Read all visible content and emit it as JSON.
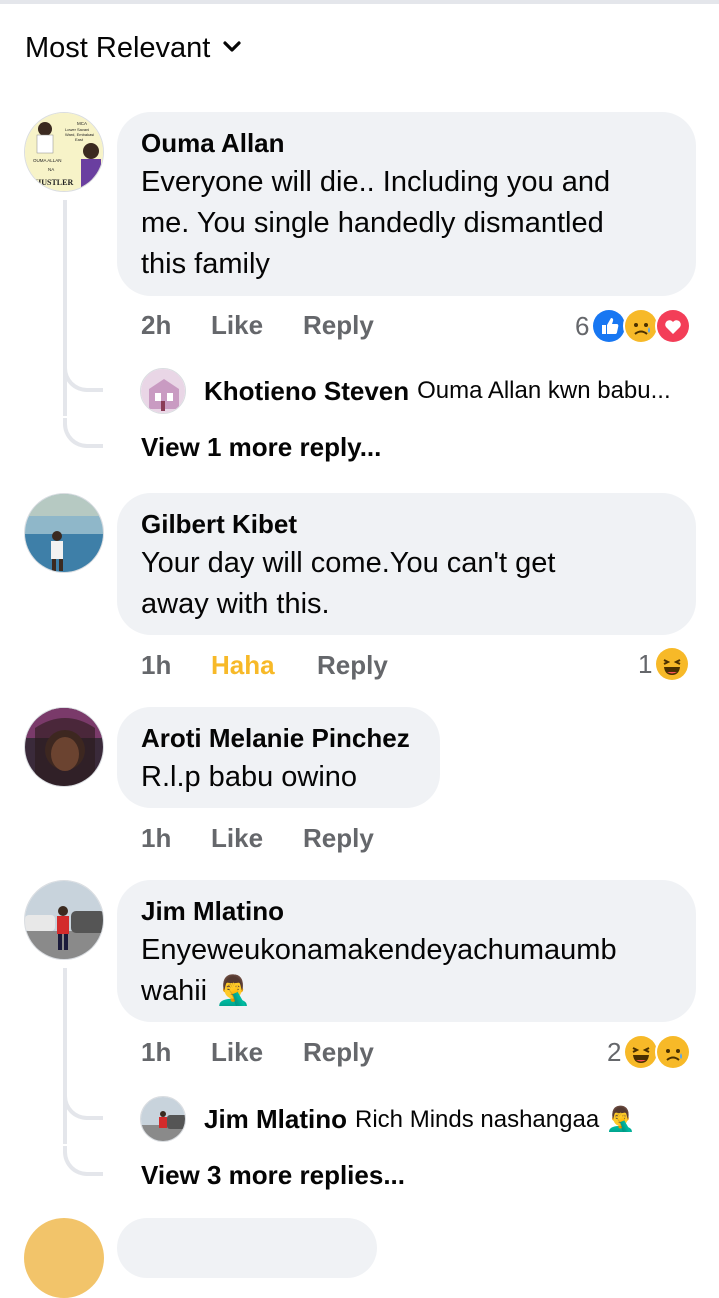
{
  "sort": {
    "label": "Most Relevant",
    "icon": "chevron-down-icon"
  },
  "comments": [
    {
      "name": "Ouma Allan",
      "lines": [
        "Everyone will die.. Including you and",
        "me. You single handedly dismantled",
        "this family"
      ],
      "time": "2h",
      "like_label": "Like",
      "reply_label": "Reply",
      "reaction_count": "6",
      "reactions": [
        "like-reaction-icon",
        "sad-reaction-icon",
        "love-reaction-icon"
      ],
      "avatar_caption": {
        "top": "MCA",
        "mid1": "Lower Savani",
        "mid2": "Ward, Embakasi",
        "mid3": "East",
        "name": "OUMA ALLAN",
        "na": "NA",
        "hustler": "HUSTLER"
      },
      "reply": {
        "name": "Khotieno Steven",
        "text": "Ouma Allan kwn babu..."
      },
      "view_more": "View 1 more reply..."
    },
    {
      "name": "Gilbert Kibet",
      "lines": [
        "Your day will come.You can't get",
        "away with this."
      ],
      "time": "1h",
      "like_label": "Haha",
      "reply_label": "Reply",
      "reaction_count": "1",
      "reactions": [
        "haha-reaction-icon"
      ]
    },
    {
      "name": "Aroti Melanie Pinchez",
      "lines": [
        "R.l.p babu owino"
      ],
      "time": "1h",
      "like_label": "Like",
      "reply_label": "Reply"
    },
    {
      "name": "Jim Mlatino",
      "lines": [
        "Enyeweukonamakendeyachumaumb",
        "wahii 🤦‍♂️"
      ],
      "time": "1h",
      "like_label": "Like",
      "reply_label": "Reply",
      "reaction_count": "2",
      "reactions": [
        "haha-reaction-icon",
        "sad-reaction-icon"
      ],
      "reply": {
        "name": "Jim Mlatino",
        "text": "Rich Minds nashangaa 🤦‍♂️"
      },
      "view_more": "View 3 more replies..."
    }
  ],
  "colors": {
    "bubble": "#f0f2f5",
    "secondary_text": "#65676b",
    "haha": "#f7b928",
    "like_blue": "#1877f2",
    "love_red": "#f33e58"
  }
}
